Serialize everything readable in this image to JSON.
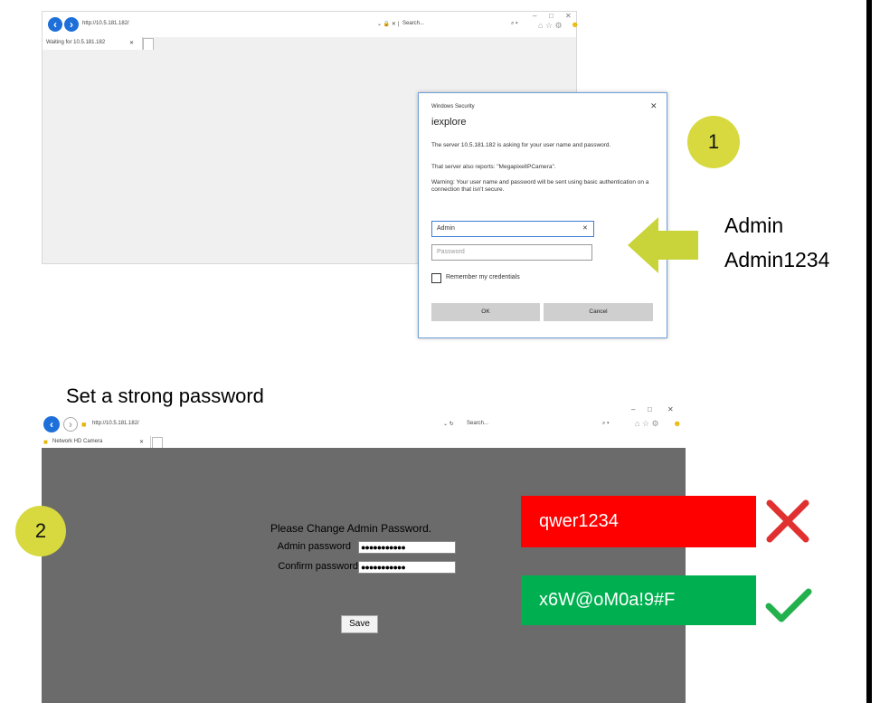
{
  "top_browser": {
    "url": "http://10.5.181.182/",
    "tab_title": "Waiting for 10.5.181.182",
    "search_placeholder": "Search...",
    "window_controls": [
      "–",
      "□",
      "✕"
    ]
  },
  "dialog": {
    "window_title": "Windows Security",
    "app_name": "iexplore",
    "message1": "The server 10.5.181.182 is asking for your user name and password.",
    "message2": "That server also reports: \"MegapixelIPCamera\".",
    "warning": "Warning: Your user name and password will be sent using basic authentication on a connection that isn't secure.",
    "username_value": "Admin",
    "password_placeholder": "Password",
    "remember_label": "Remember my credentials",
    "ok_label": "OK",
    "cancel_label": "Cancel"
  },
  "step1": {
    "number": "1",
    "credential_user": "Admin",
    "credential_pass": "Admin1234"
  },
  "step2": {
    "heading": "Set a strong password",
    "number": "2"
  },
  "bottom_browser": {
    "url": "http://10.5.181.182/",
    "tab_title": "Network HD Camera",
    "search_placeholder": "Search...",
    "window_controls": [
      "–",
      "□",
      "✕"
    ],
    "form_title": "Please Change Admin Password.",
    "admin_password_label": "Admin password",
    "confirm_password_label": "Confirm password",
    "admin_password_value": "●●●●●●●●●●●",
    "confirm_password_value": "●●●●●●●●●●●",
    "save_label": "Save"
  },
  "examples": {
    "weak_password": "qwer1234",
    "strong_password": "x6W@oM0a!9#F"
  },
  "colors": {
    "step_circle": "#d7d93f",
    "arrow": "#c8d43a",
    "weak_badge": "#ff0000",
    "strong_badge": "#00b050",
    "cross_icon": "#e03030",
    "check_icon": "#22b14c"
  }
}
